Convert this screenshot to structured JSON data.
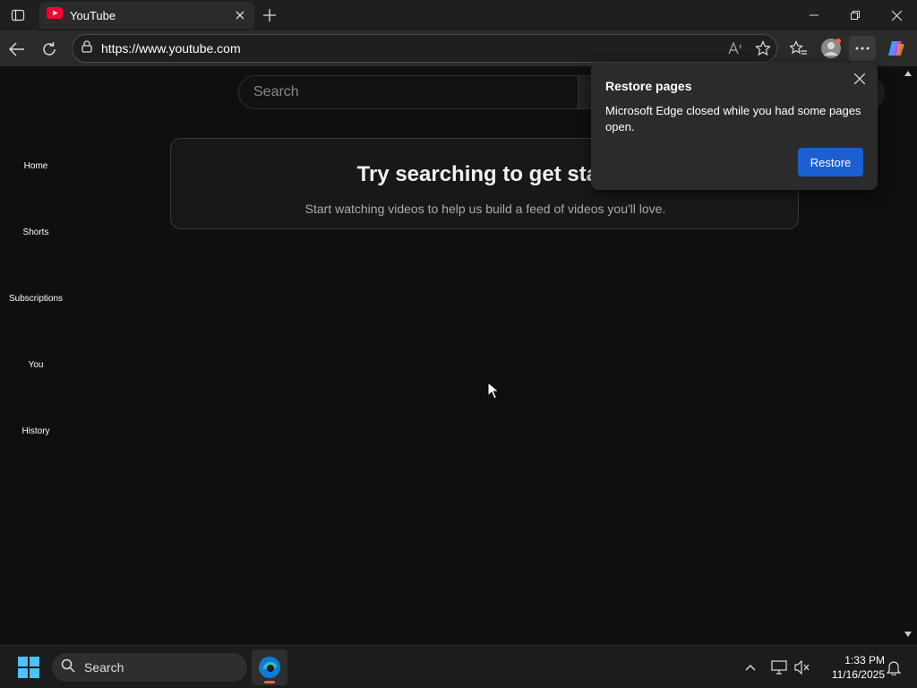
{
  "browser": {
    "tab": {
      "title": "YouTube",
      "favicon": "youtube-icon"
    },
    "url": "https://www.youtube.com",
    "colors": {
      "frame": "#1f1f1f",
      "toolbar": "#2b2b2b",
      "accent": "#1b5fd1"
    }
  },
  "youtube": {
    "search_placeholder": "Search",
    "sidebar": [
      {
        "label": "Home"
      },
      {
        "label": "Shorts"
      },
      {
        "label": "Subscriptions"
      },
      {
        "label": "You"
      },
      {
        "label": "History"
      }
    ],
    "card": {
      "title": "Try searching to get start",
      "subtitle": "Start watching videos to help us build a feed of videos you'll love."
    }
  },
  "popup": {
    "title": "Restore pages",
    "body": "Microsoft Edge closed while you had some pages open.",
    "button": "Restore"
  },
  "taskbar": {
    "search_label": "Search",
    "time": "1:33 PM",
    "date": "11/16/2025"
  }
}
